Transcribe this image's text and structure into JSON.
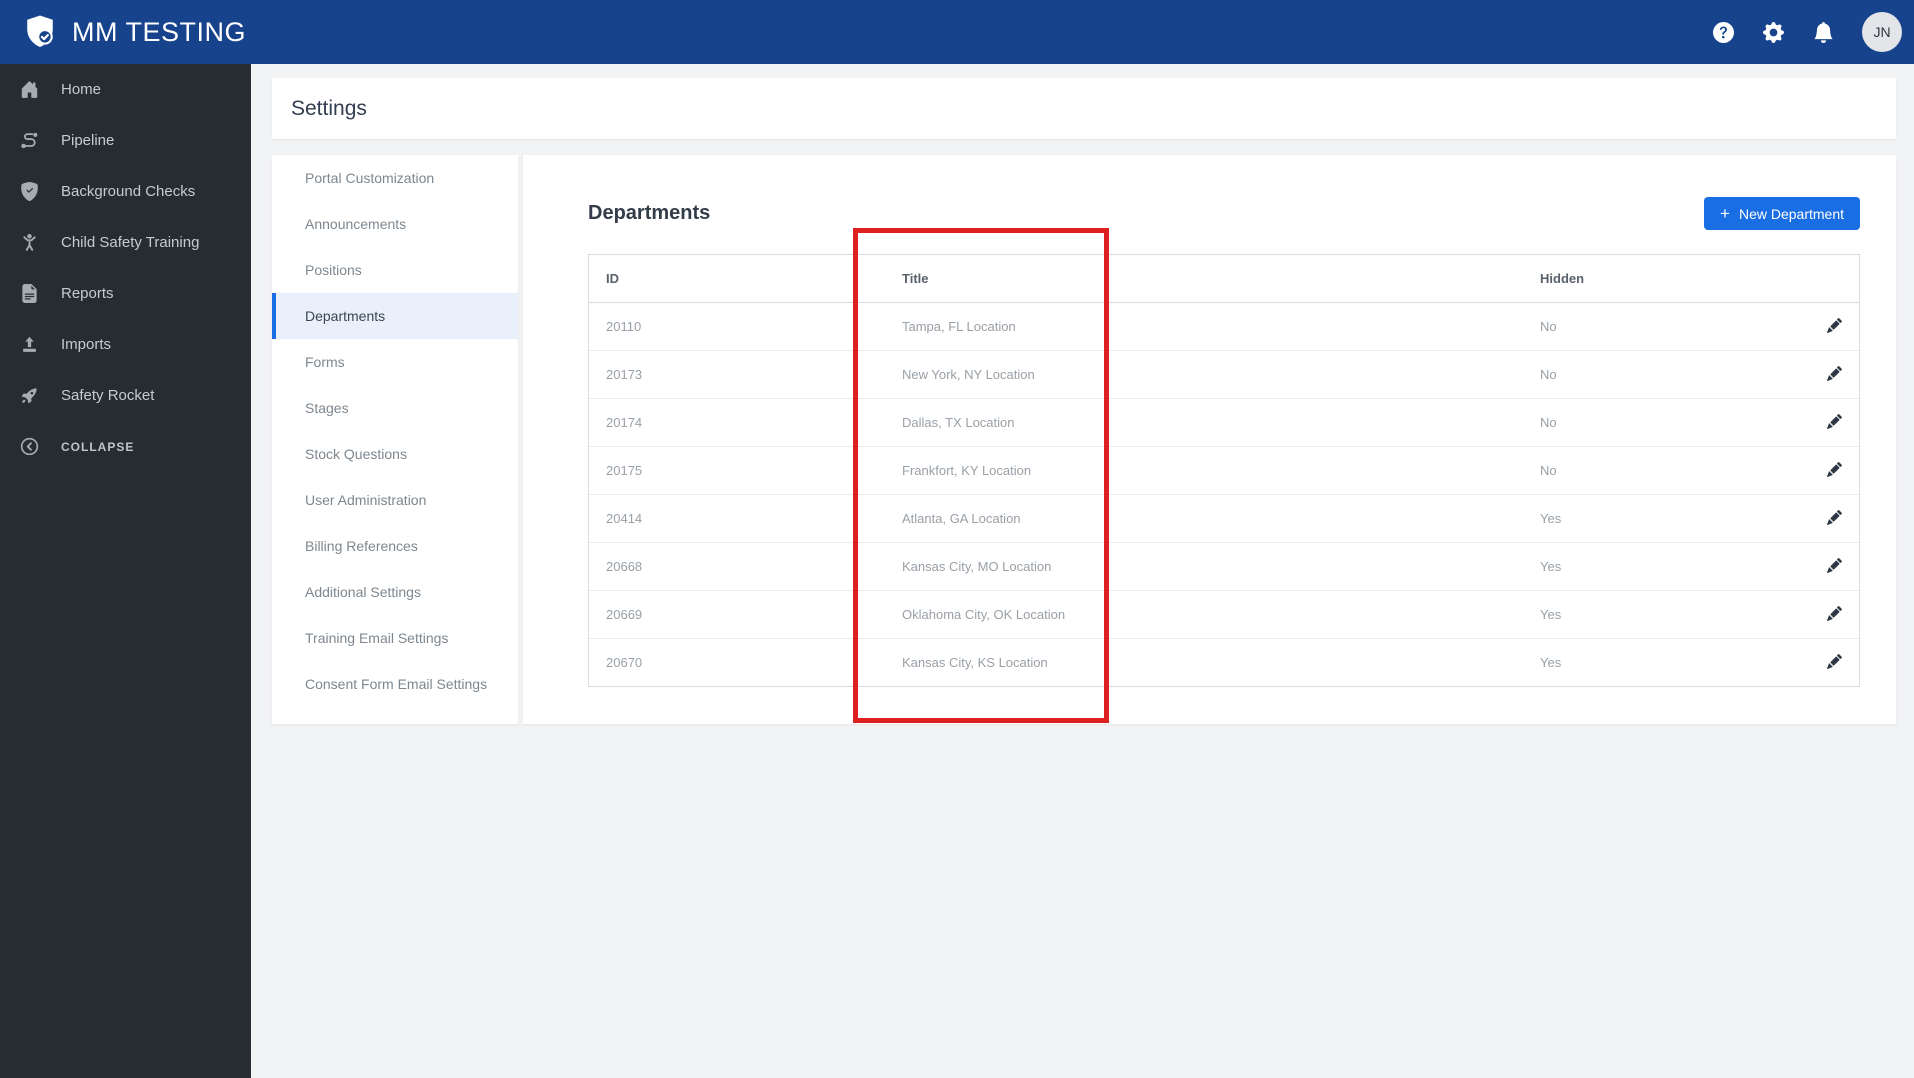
{
  "navbar": {
    "brand": "MM TESTING",
    "logo_icon": "shield-check-logo",
    "icons": [
      "help-icon",
      "gear-icon",
      "bell-icon"
    ],
    "avatar": {
      "initials": "JN"
    },
    "color": "#17428c"
  },
  "sidebar": {
    "color": "#262c31",
    "items": [
      {
        "label": "Home",
        "icon": "home-icon"
      },
      {
        "label": "Pipeline",
        "icon": "pipeline-icon"
      },
      {
        "label": "Background Checks",
        "icon": "shield-check-icon"
      },
      {
        "label": "Child Safety Training",
        "icon": "child-icon"
      },
      {
        "label": "Reports",
        "icon": "document-icon"
      },
      {
        "label": "Imports",
        "icon": "upload-icon"
      },
      {
        "label": "Safety Rocket",
        "icon": "rocket-icon"
      }
    ],
    "collapse_label": "COLLAPSE",
    "collapse_icon": "chevron-left-circle-icon"
  },
  "page": {
    "title": "Settings"
  },
  "subnav": {
    "active_color": "#1a6ee3",
    "items": [
      {
        "label": "Portal Customization",
        "active": false
      },
      {
        "label": "Announcements",
        "active": false
      },
      {
        "label": "Positions",
        "active": false
      },
      {
        "label": "Departments",
        "active": true
      },
      {
        "label": "Forms",
        "active": false
      },
      {
        "label": "Stages",
        "active": false
      },
      {
        "label": "Stock Questions",
        "active": false
      },
      {
        "label": "User Administration",
        "active": false
      },
      {
        "label": "Billing References",
        "active": false
      },
      {
        "label": "Additional Settings",
        "active": false
      },
      {
        "label": "Training Email Settings",
        "active": false
      },
      {
        "label": "Consent Form Email Settings",
        "active": false
      }
    ]
  },
  "content": {
    "heading": "Departments",
    "new_button": {
      "label": "New Department",
      "icon": "plus-icon",
      "color": "#1a6ee3"
    },
    "table": {
      "columns": [
        "ID",
        "Title",
        "Hidden"
      ],
      "row_action_icon": "pencil-icon",
      "rows": [
        {
          "id": "20110",
          "title": "Tampa, FL Location",
          "hidden": "No"
        },
        {
          "id": "20173",
          "title": "New York, NY Location",
          "hidden": "No"
        },
        {
          "id": "20174",
          "title": "Dallas, TX Location",
          "hidden": "No"
        },
        {
          "id": "20175",
          "title": "Frankfort, KY Location",
          "hidden": "No"
        },
        {
          "id": "20414",
          "title": "Atlanta, GA Location",
          "hidden": "Yes"
        },
        {
          "id": "20668",
          "title": "Kansas City, MO Location",
          "hidden": "Yes"
        },
        {
          "id": "20669",
          "title": "Oklahoma City, OK Location",
          "hidden": "Yes"
        },
        {
          "id": "20670",
          "title": "Kansas City, KS Location",
          "hidden": "Yes"
        }
      ]
    }
  },
  "annotation": {
    "shape": "rectangle",
    "color": "#de2020",
    "target": "Title column"
  }
}
